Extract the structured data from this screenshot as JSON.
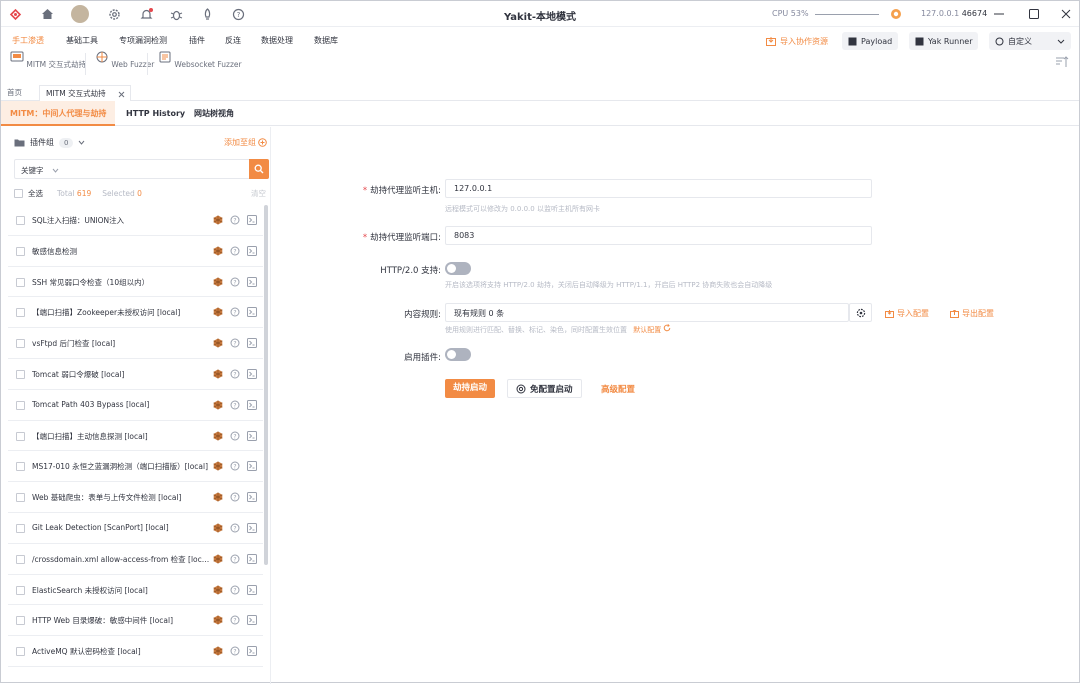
{
  "window": {
    "title": "Yakit-本地模式",
    "cpu": "CPU 53%",
    "ip": "127.0.0.1",
    "port": "46674"
  },
  "menu": [
    "手工渗透",
    "基础工具",
    "专项漏洞检测",
    "插件",
    "反连",
    "数据处理",
    "数据库"
  ],
  "top_actions": {
    "import": "导入协作资源",
    "payload": "Payload",
    "yak_runner": "Yak Runner",
    "custom": "自定义"
  },
  "tools": [
    "MITM 交互式劫持",
    "Web Fuzzer",
    "Websocket Fuzzer"
  ],
  "page_tabs": {
    "home": "首页",
    "mitm": "MITM 交互式劫持"
  },
  "sub_tabs": [
    "MITM：中间人代理与劫持",
    "HTTP History",
    "网站树视角"
  ],
  "plugin_panel": {
    "group_label": "插件组",
    "group_count": "0",
    "add_label": "添加至组",
    "keyword": "关键字",
    "select_all": "全选",
    "total_label": "Total",
    "total": "619",
    "selected_label": "Selected",
    "selected": "0",
    "clear": "清空",
    "plugins": [
      "SQL注入扫描：UNION注入",
      "敏感信息检测",
      "SSH 常见弱口令检查（10组以内）",
      "【端口扫描】Zookeeper未授权访问 [local]",
      "vsFtpd 后门检查 [local]",
      "Tomcat 弱口令爆破 [local]",
      "Tomcat Path 403 Bypass [local]",
      "【端口扫描】主动信息探测 [local]",
      "MS17-010 永恒之蓝漏洞检测（端口扫描版）[local]",
      "Web 基础爬虫：表单与上传文件检测 [local]",
      "Git Leak Detection [ScanPort] [local]",
      "/crossdomain.xml allow-access-from 检查 [local]",
      "ElasticSearch 未授权访问 [local]",
      "HTTP Web 目录爆破：敏感中间件 [local]",
      "ActiveMQ 默认密码检查 [local]"
    ]
  },
  "form": {
    "host_label": "劫持代理监听主机:",
    "host_value": "127.0.0.1",
    "host_help": "远程模式可以修改为 0.0.0.0 以监听主机所有网卡",
    "port_label": "劫持代理监听端口:",
    "port_value": "8083",
    "http2_label": "HTTP/2.0 支持:",
    "http2_help": "开启该选项将支持 HTTP/2.0 劫持，关闭后自动降级为 HTTP/1.1，开启后 HTTP2 协商失败也会自动降级",
    "rules_label": "内容规则:",
    "rules_value": "现有规则 0 条",
    "rules_import": "导入配置",
    "rules_export": "导出配置",
    "rules_help": "使用规则进行匹配、替换、标记、染色，同时配置生效位置",
    "rules_default": "默认配置",
    "plugins_label": "启用插件:",
    "start_button": "劫持启动",
    "no_config_button": "免配置启动",
    "advanced_button": "高级配置"
  },
  "colors": {
    "accent": "#f28b44",
    "text": "#31343f",
    "muted": "#b6bac5",
    "required": "#e5484d"
  }
}
